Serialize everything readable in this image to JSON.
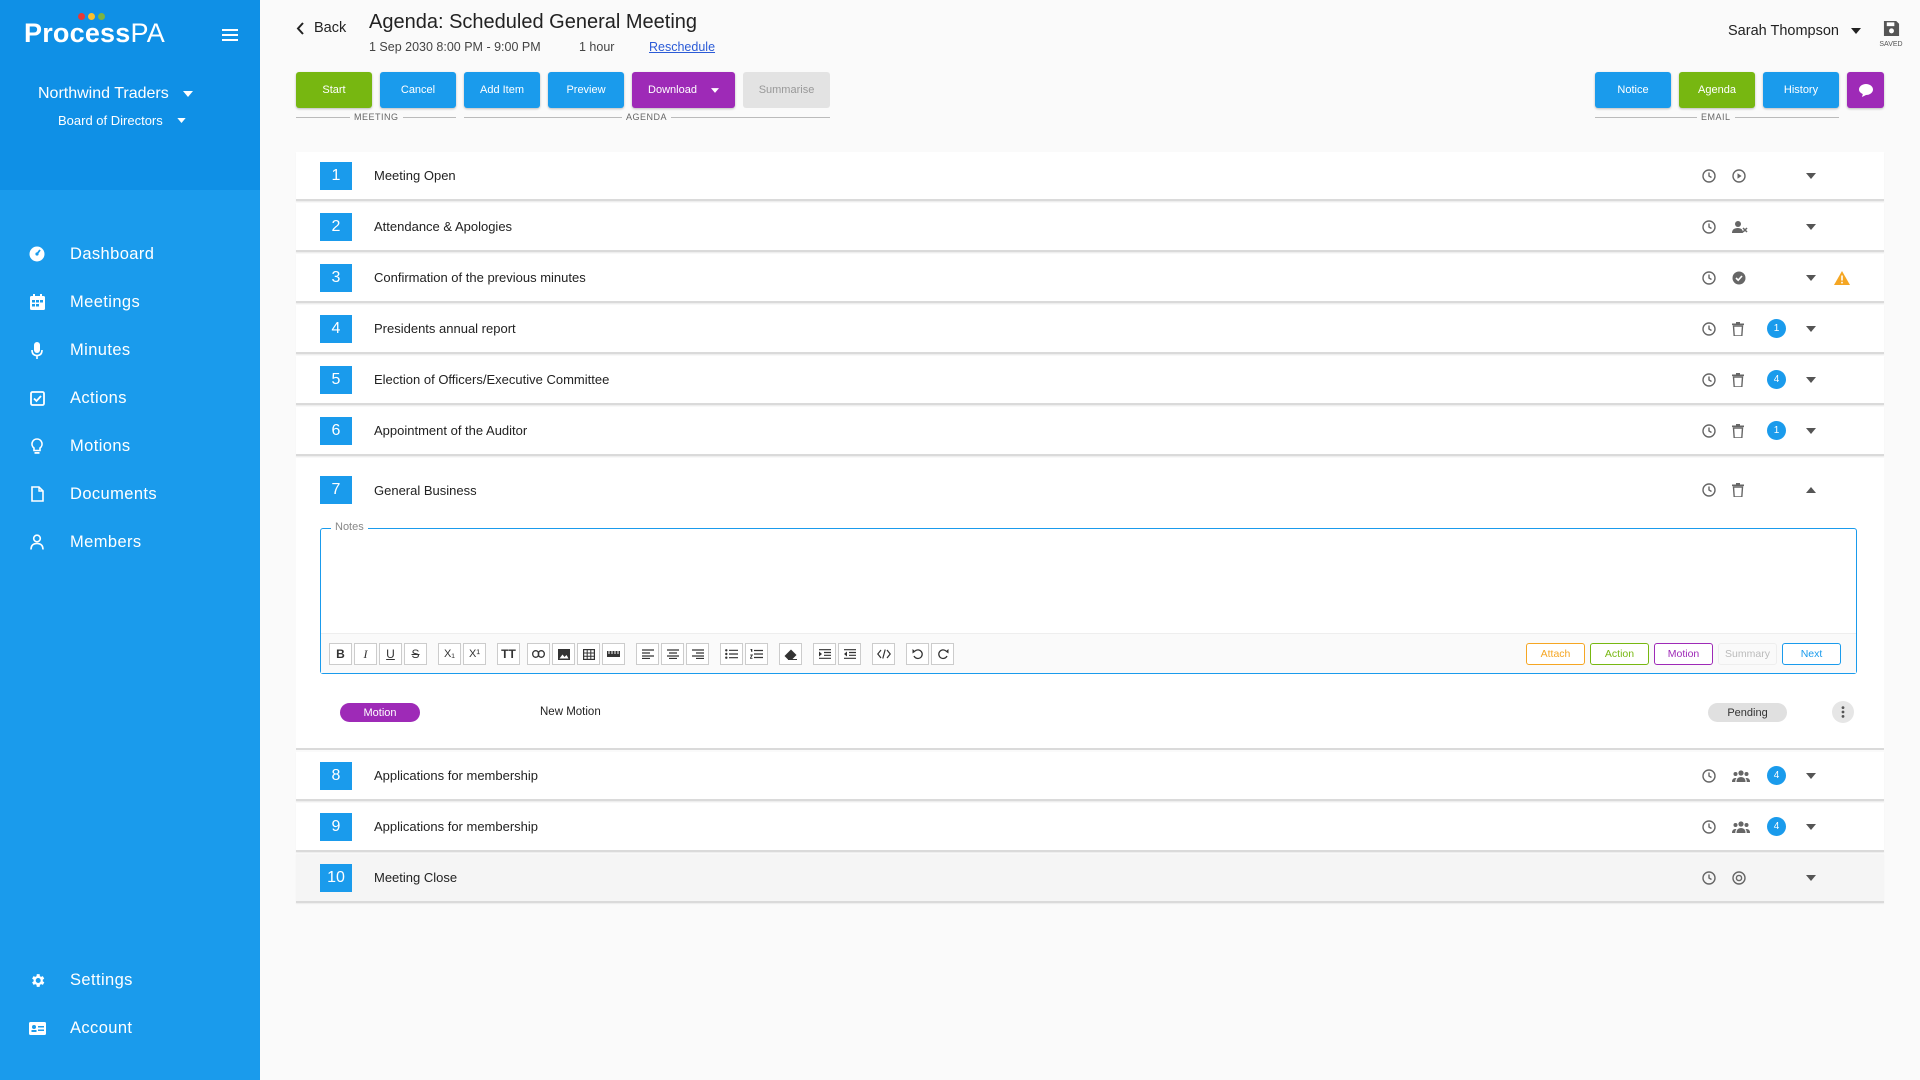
{
  "sidebar": {
    "logo_main": "Process",
    "logo_accent": "PA",
    "org": "Northwind Traders",
    "board": "Board of Directors",
    "nav": [
      {
        "label": "Dashboard",
        "icon": "dashboard-icon"
      },
      {
        "label": "Meetings",
        "icon": "calendar-icon"
      },
      {
        "label": "Minutes",
        "icon": "microphone-icon"
      },
      {
        "label": "Actions",
        "icon": "checkbox-icon"
      },
      {
        "label": "Motions",
        "icon": "lightbulb-icon"
      },
      {
        "label": "Documents",
        "icon": "document-icon"
      },
      {
        "label": "Members",
        "icon": "person-icon"
      }
    ],
    "bottom": [
      {
        "label": "Settings",
        "icon": "gear-icon"
      },
      {
        "label": "Account",
        "icon": "id-card-icon"
      }
    ]
  },
  "header": {
    "back": "Back",
    "title": "Agenda: Scheduled General Meeting",
    "date": "1 Sep 2030 8:00 PM - 9:00 PM",
    "duration": "1 hour",
    "reschedule": "Reschedule",
    "user": "Sarah Thompson",
    "saved": "SAVED"
  },
  "toolbar": {
    "start": "Start",
    "cancel": "Cancel",
    "add_item": "Add Item",
    "preview": "Preview",
    "download": "Download",
    "summarise": "Summarise",
    "notice": "Notice",
    "agenda": "Agenda",
    "history": "History",
    "group_meeting": "MEETING",
    "group_agenda": "AGENDA",
    "group_email": "EMAIL"
  },
  "agenda": {
    "items": [
      {
        "num": "1",
        "title": "Meeting Open",
        "icon": "play-circle-icon",
        "badge": ""
      },
      {
        "num": "2",
        "title": "Attendance & Apologies",
        "icon": "person-remove-icon",
        "badge": ""
      },
      {
        "num": "3",
        "title": "Confirmation of the previous minutes",
        "icon": "check-circle-icon",
        "badge": "",
        "warning": true
      },
      {
        "num": "4",
        "title": "Presidents annual report",
        "icon": "trash-icon",
        "badge": "1"
      },
      {
        "num": "5",
        "title": "Election of Officers/Executive Committee",
        "icon": "trash-icon",
        "badge": "4"
      },
      {
        "num": "6",
        "title": "Appointment of the Auditor",
        "icon": "trash-icon",
        "badge": "1"
      }
    ],
    "expanded": {
      "num": "7",
      "title": "General Business",
      "notes_label": "Notes",
      "attach": "Attach",
      "action": "Action",
      "motion": "Motion",
      "summary": "Summary",
      "next": "Next",
      "motion_pill": "Motion",
      "motion_name": "New Motion",
      "motion_status": "Pending"
    },
    "after": [
      {
        "num": "8",
        "title": "Applications for membership",
        "icon": "group-icon",
        "badge": "4"
      },
      {
        "num": "9",
        "title": "Applications for membership",
        "icon": "group-icon",
        "badge": "4"
      },
      {
        "num": "10",
        "title": "Meeting Close",
        "icon": "stop-circle-icon",
        "badge": ""
      }
    ]
  },
  "colors": {
    "primary": "#1a9bec",
    "green": "#77b711",
    "purple": "#9e2ab7",
    "warning": "#f5a623"
  }
}
